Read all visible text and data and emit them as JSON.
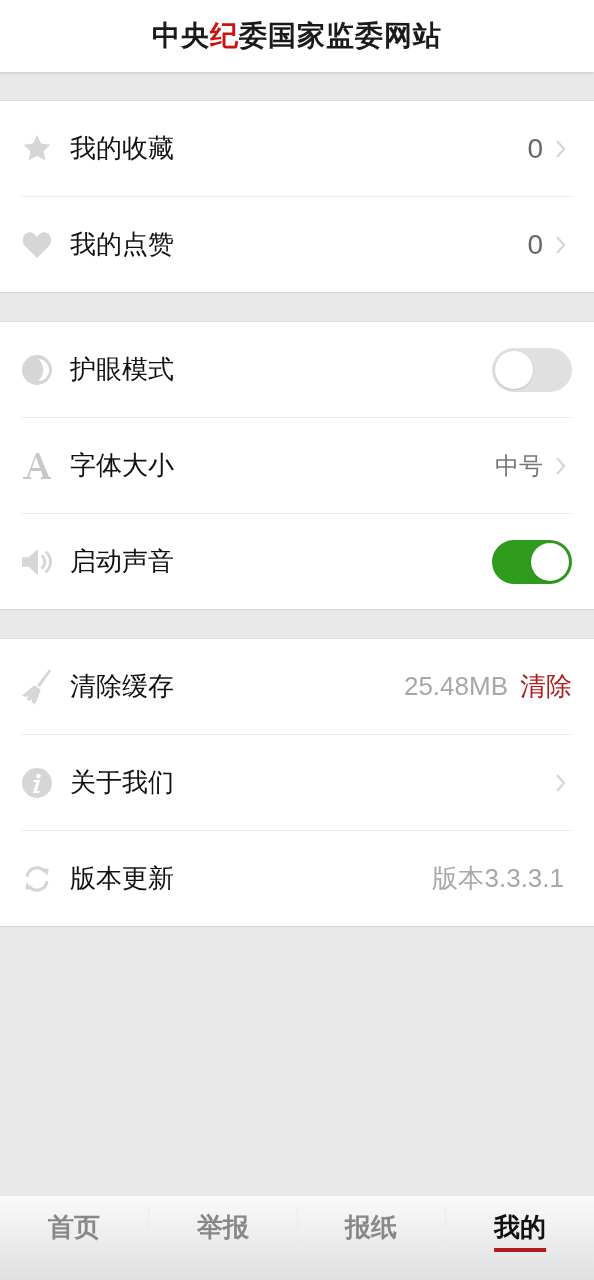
{
  "header": {
    "title_parts": [
      {
        "text": "中央",
        "highlight": false
      },
      {
        "text": "纪",
        "highlight": true
      },
      {
        "text": "委国家监委网站",
        "highlight": false
      }
    ]
  },
  "sections": [
    {
      "items": [
        {
          "kind": "count",
          "label": "我的收藏",
          "value": "0"
        },
        {
          "kind": "count",
          "label": "我的点赞",
          "value": "0"
        }
      ]
    },
    {
      "items": [
        {
          "kind": "toggle",
          "label": "护眼模式",
          "on": false
        },
        {
          "kind": "value",
          "label": "字体大小",
          "value": "中号"
        },
        {
          "kind": "toggle",
          "label": "启动声音",
          "on": true
        }
      ]
    },
    {
      "items": [
        {
          "kind": "cache",
          "label": "清除缓存",
          "value": "25.48MB",
          "action": "清除"
        },
        {
          "kind": "link",
          "label": "关于我们"
        },
        {
          "kind": "version",
          "label": "版本更新",
          "value": "版本3.3.3.1"
        }
      ]
    }
  ],
  "tabs": [
    {
      "label": "首页",
      "selected": false
    },
    {
      "label": "举报",
      "selected": false
    },
    {
      "label": "报纸",
      "selected": false
    },
    {
      "label": "我的",
      "selected": true
    }
  ]
}
